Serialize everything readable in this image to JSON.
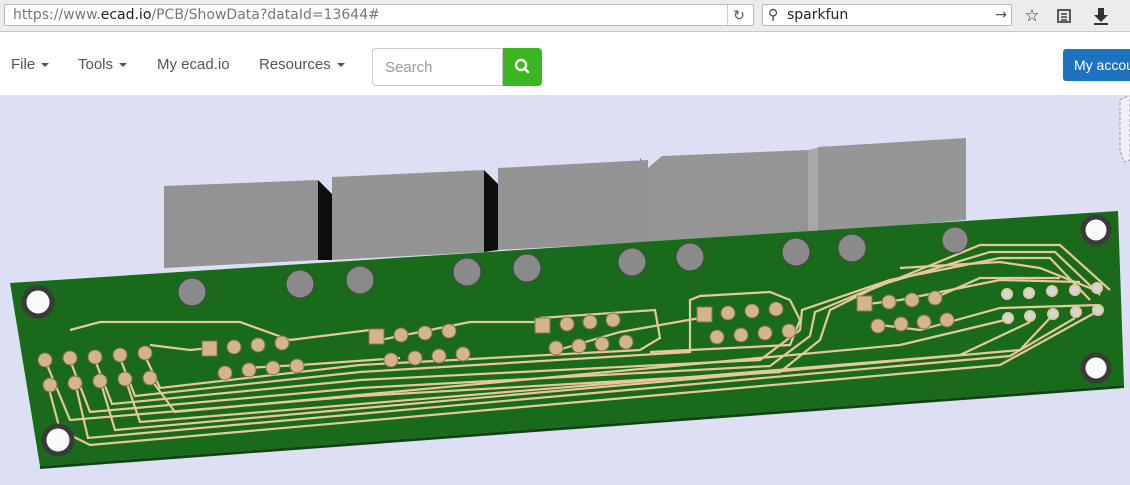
{
  "browser": {
    "url_prefix": "https://www.",
    "url_host": "ecad.io",
    "url_path": "/PCB/ShowData?dataId=13644#",
    "search_value": "sparkfun",
    "icons": [
      "reload-icon",
      "search-icon",
      "go-arrow-icon",
      "bookmark-star-icon",
      "reading-list-icon",
      "download-icon"
    ]
  },
  "navbar": {
    "file": "File",
    "tools": "Tools",
    "my_ecad": "My ecad.io",
    "resources": "Resources",
    "search_placeholder": "Search",
    "account": "My account"
  },
  "colors": {
    "pcb": "#196b1b",
    "trace": "#e6c89a",
    "component": "#8f8f8f",
    "background": "#dde0f5",
    "search_button": "#3cb521",
    "account_button": "#1e73be"
  }
}
